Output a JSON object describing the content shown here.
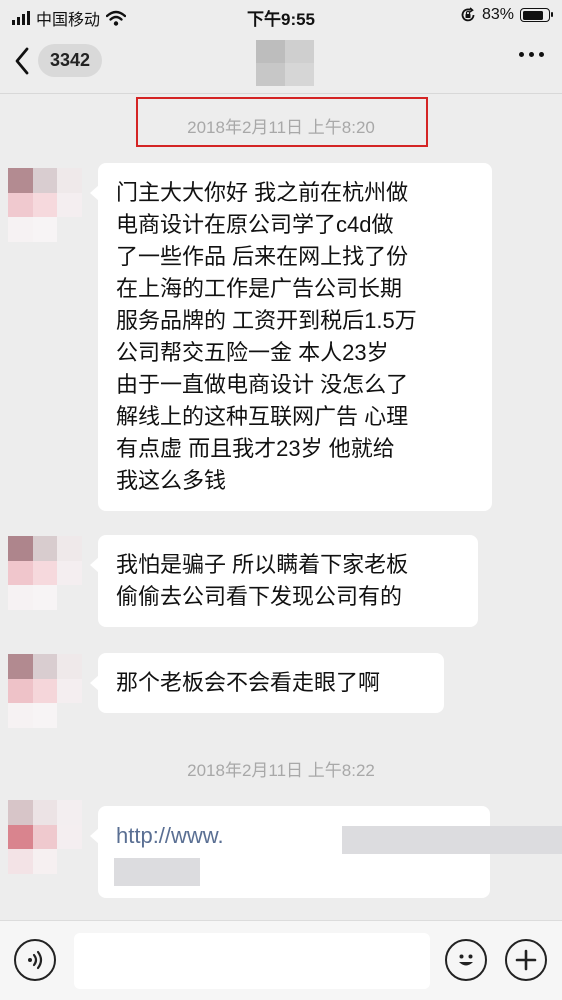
{
  "status_bar": {
    "carrier": "中国移动",
    "time": "下午9:55",
    "battery_percent": "83%",
    "battery_level": 0.83,
    "icons": [
      "signal-icon",
      "wifi-icon",
      "orientation-lock-icon",
      "battery-icon"
    ]
  },
  "nav": {
    "unread_count": "3342",
    "icons": [
      "back-chevron-icon",
      "more-icon"
    ]
  },
  "conversation": {
    "timestamps": [
      "2018年2月11日 上午8:20",
      "2018年2月11日 上午8:22"
    ],
    "messages": [
      {
        "lines": [
          "门主大大你好 我之前在杭州做",
          "电商设计在原公司学了c4d做",
          "了一些作品 后来在网上找了份",
          "在上海的工作是广告公司长期",
          "服务品牌的 工资开到税后1.5万",
          " 公司帮交五险一金  本人23岁",
          " 由于一直做电商设计  没怎么了",
          "解线上的这种互联网广告  心理",
          "有点虚  而且我才23岁  他就给",
          "我这么多钱"
        ]
      },
      {
        "lines": [
          "我怕是骗子 所以瞒着下家老板",
          "偷偷去公司看下发现公司有的"
        ]
      },
      {
        "lines": [
          "那个老板会不会看走眼了啊"
        ]
      },
      {
        "link_text": "http://www."
      }
    ]
  },
  "input_bar": {
    "icons": [
      "voice-icon",
      "emoji-icon",
      "add-icon"
    ]
  },
  "colors": {
    "background": "#ededed",
    "bubble": "#ffffff",
    "highlight_border": "#d42424",
    "link": "#5a6f93",
    "timestamp_text": "#a8a8a8"
  }
}
